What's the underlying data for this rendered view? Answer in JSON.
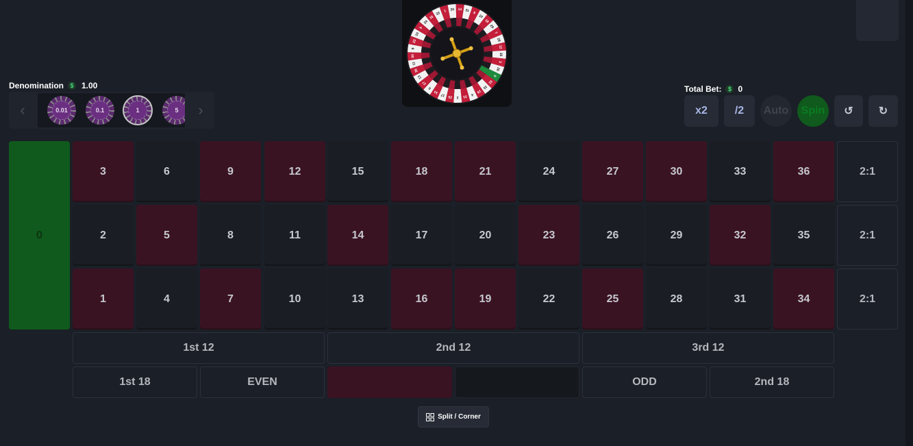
{
  "wheel": {
    "numbers": [
      "0",
      "32",
      "15",
      "19",
      "4",
      "21",
      "2",
      "25",
      "17",
      "34",
      "6",
      "27",
      "13",
      "36",
      "11",
      "30",
      "8",
      "23",
      "10",
      "5",
      "24",
      "16",
      "33",
      "1",
      "20",
      "14",
      "31",
      "9",
      "22",
      "18",
      "29",
      "7",
      "28",
      "12",
      "35",
      "3",
      "26"
    ]
  },
  "denomination": {
    "label": "Denomination",
    "currency_icon": "$",
    "value": "1.00"
  },
  "chips": [
    {
      "label": "0.01",
      "selected": false
    },
    {
      "label": "0.1",
      "selected": false
    },
    {
      "label": "1",
      "selected": true
    },
    {
      "label": "5",
      "selected": false
    }
  ],
  "chip_nav": {
    "prev_icon": "‹",
    "next_icon": "›"
  },
  "total_bet": {
    "label": "Total Bet:",
    "currency_icon": "$",
    "value": "0"
  },
  "controls": {
    "double": "x2",
    "half": "/2",
    "auto": "Auto",
    "spin": "Spin",
    "undo_icon": "↺",
    "clear_icon": "↻"
  },
  "table": {
    "zero": "0",
    "rows": [
      [
        "3",
        "6",
        "9",
        "12",
        "15",
        "18",
        "21",
        "24",
        "27",
        "30",
        "33",
        "36"
      ],
      [
        "2",
        "5",
        "8",
        "11",
        "14",
        "17",
        "20",
        "23",
        "26",
        "29",
        "32",
        "35"
      ],
      [
        "1",
        "4",
        "7",
        "10",
        "13",
        "16",
        "19",
        "22",
        "25",
        "28",
        "31",
        "34"
      ]
    ],
    "columns": [
      "2:1",
      "2:1",
      "2:1"
    ],
    "dozens": [
      "1st 12",
      "2nd 12",
      "3rd 12"
    ],
    "outside": {
      "low": "1st 18",
      "even": "EVEN",
      "red": "",
      "black": "",
      "odd": "ODD",
      "high": "2nd 18"
    }
  },
  "split_corner": "Split / Corner",
  "colors": {
    "red": "#3a1322",
    "black": "#1a1d23",
    "green": "#0f5a1c",
    "wheel_red": "#c41e3a"
  }
}
